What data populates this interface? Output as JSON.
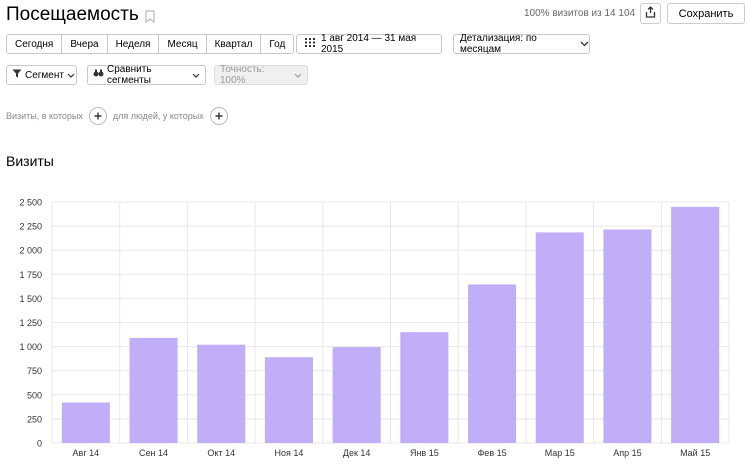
{
  "header": {
    "title": "Посещаемость",
    "stats": "100% визитов из 14 104",
    "save_label": "Сохранить"
  },
  "periods": [
    {
      "label": "Сегодня",
      "selected": false
    },
    {
      "label": "Вчера",
      "selected": false
    },
    {
      "label": "Неделя",
      "selected": false
    },
    {
      "label": "Месяц",
      "selected": false
    },
    {
      "label": "Квартал",
      "selected": false
    },
    {
      "label": "Год",
      "selected": false
    }
  ],
  "date_range": "1 авг 2014 — 31 мая 2015",
  "detail": "Детализация: по месяцам",
  "segment": {
    "segment_label": "Сегмент",
    "compare_label": "Сравнить сегменты",
    "accuracy_label": "Точность: 100%"
  },
  "filter": {
    "visits_label": "Визиты, в которых",
    "people_label": "для людей, у которых"
  },
  "section_title": "Визиты",
  "icons": [
    "bookmark-icon",
    "share-icon",
    "calendar-icon",
    "funnel-icon",
    "compare-icon",
    "chevron-down-icon",
    "plus-icon"
  ],
  "colors": {
    "bar": "#c0aef9",
    "grid": "#e8e8e8"
  },
  "chart_data": {
    "type": "bar",
    "categories": [
      "Авг 14",
      "Сен 14",
      "Окт 14",
      "Ноя 14",
      "Дек 14",
      "Янв 15",
      "Фев 15",
      "Мар 15",
      "Апр 15",
      "Май 15"
    ],
    "values": [
      420,
      1090,
      1020,
      890,
      995,
      1150,
      1645,
      2185,
      2215,
      2450
    ],
    "ylim": [
      0,
      2500
    ],
    "yticks": [
      0,
      250,
      500,
      750,
      1000,
      1250,
      1500,
      1750,
      2000,
      2250,
      2500
    ],
    "ytick_labels": [
      "0",
      "250",
      "500",
      "750",
      "1 000",
      "1 250",
      "1 500",
      "1 750",
      "2 000",
      "2 250",
      "2 500"
    ],
    "grid": true,
    "title": "",
    "xlabel": "",
    "ylabel": ""
  }
}
